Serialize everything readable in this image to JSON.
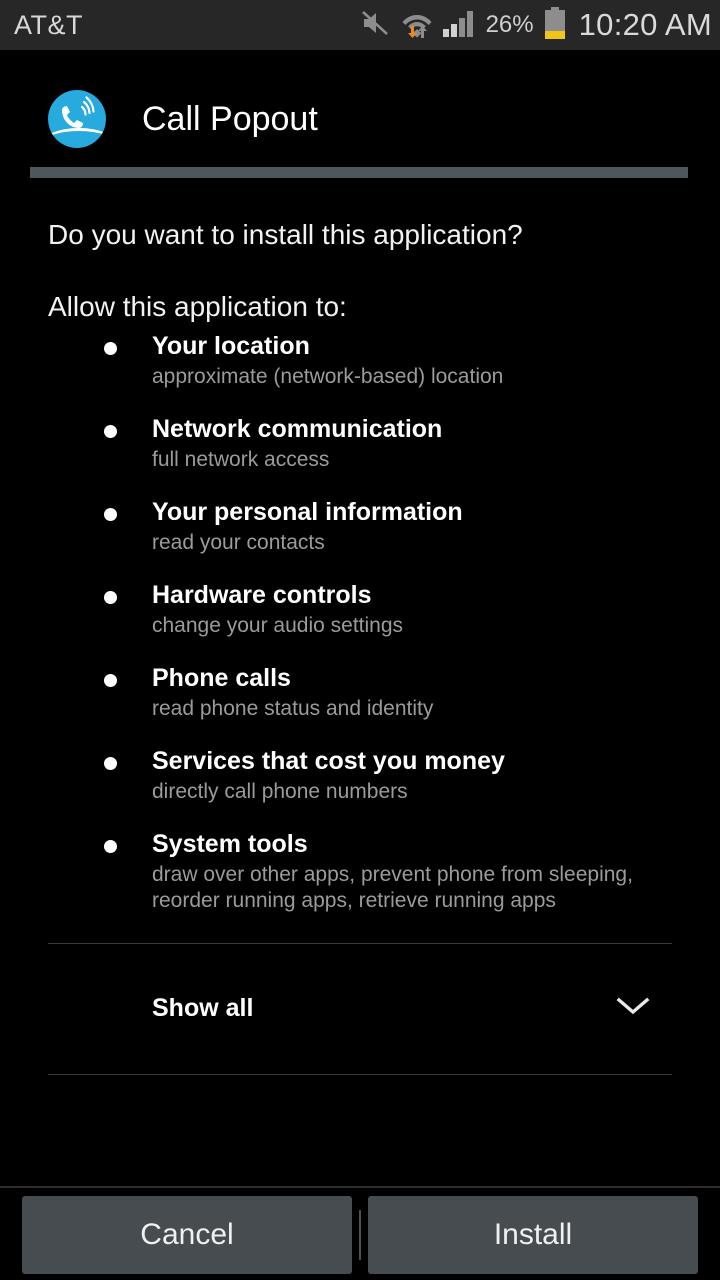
{
  "status_bar": {
    "carrier": "AT&T",
    "battery_percent": "26%",
    "clock": "10:20 AM",
    "icons": {
      "mute": "mute-icon",
      "wifi": "wifi-icon",
      "signal": "signal-icon",
      "battery": "battery-icon"
    },
    "colors": {
      "background": "#272727",
      "text": "#d8d8d8",
      "battery_fill": "#f0c419",
      "wifi_activity": "#f08a1e"
    }
  },
  "header": {
    "app_name": "Call Popout",
    "icon_name": "call-popout-app-icon",
    "icon_color": "#27aadd",
    "separator_color": "#4e585c"
  },
  "body": {
    "question": "Do you want to install this application?",
    "allow_label": "Allow this application to:"
  },
  "permissions": [
    {
      "title": "Your location",
      "description": "approximate (network-based) location"
    },
    {
      "title": "Network communication",
      "description": "full network access"
    },
    {
      "title": "Your personal information",
      "description": "read your contacts"
    },
    {
      "title": "Hardware controls",
      "description": "change your audio settings"
    },
    {
      "title": "Phone calls",
      "description": "read phone status and identity"
    },
    {
      "title": "Services that cost you money",
      "description": "directly call phone numbers"
    },
    {
      "title": "System tools",
      "description": "draw over other apps, prevent phone from sleeping, reorder running apps, retrieve running apps"
    }
  ],
  "show_all": {
    "label": "Show all",
    "chevron_icon": "chevron-down-icon"
  },
  "buttons": {
    "cancel_label": "Cancel",
    "install_label": "Install",
    "background_color": "#474c50"
  }
}
